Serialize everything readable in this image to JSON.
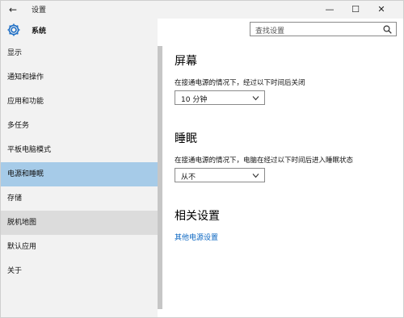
{
  "window": {
    "title": "设置"
  },
  "title_controls": {
    "back": "←",
    "minimize": "—",
    "maximize": "☐",
    "close": "✕"
  },
  "sidebar": {
    "title": "系统",
    "items": [
      {
        "label": "显示"
      },
      {
        "label": "通知和操作"
      },
      {
        "label": "应用和功能"
      },
      {
        "label": "多任务"
      },
      {
        "label": "平板电脑模式"
      },
      {
        "label": "电源和睡眠",
        "state": "selected"
      },
      {
        "label": "存储"
      },
      {
        "label": "脱机地图",
        "state": "hover"
      },
      {
        "label": "默认应用"
      },
      {
        "label": "关于"
      }
    ]
  },
  "search": {
    "placeholder": "查找设置"
  },
  "screen_section": {
    "heading": "屏幕",
    "desc": "在接通电源的情况下，经过以下时间后关闭",
    "value": "10 分钟"
  },
  "sleep_section": {
    "heading": "睡眠",
    "desc": "在接通电源的情况下，电脑在经过以下时间后进入睡眠状态",
    "value": "从不"
  },
  "related": {
    "heading": "相关设置",
    "link": "其他电源设置"
  },
  "colors": {
    "selected": "#a6cbe8",
    "hover": "#dcdcdc",
    "link": "#0a66c2",
    "sidebar_bg": "#f2f2f2"
  }
}
